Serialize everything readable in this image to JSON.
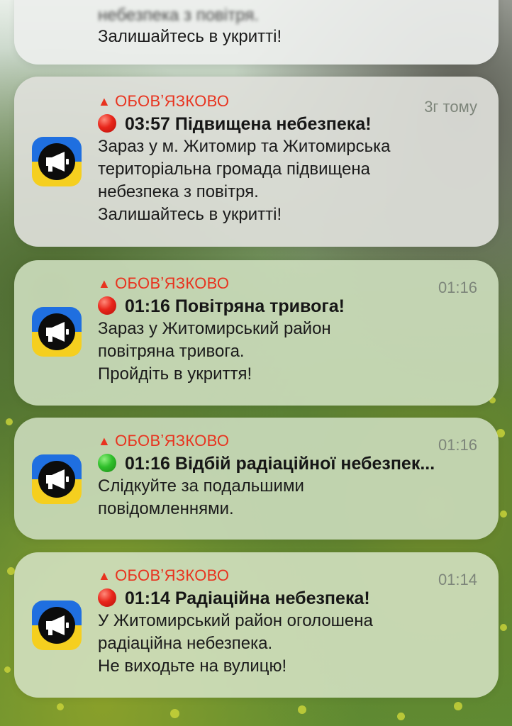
{
  "colors": {
    "mandatory_red": "#e8331f",
    "time_gray": "#7d857a",
    "alert_red": "#e8261b",
    "all_clear_green": "#2fbf2b",
    "icon_blue": "#1f6fe0",
    "icon_yellow": "#f5cf1f"
  },
  "app_icon": "megaphone-icon",
  "top_partial": {
    "blurred_line": "небезпека з повітря.",
    "body_line": "Залишайтесь в укритті!"
  },
  "notifications": [
    {
      "tag": "ОБОВʼЯЗКОВО",
      "time": "3г тому",
      "status_dot": "red",
      "title": "03:57 Підвищена небезпека!",
      "body": "Зараз у м. Житомир та Житомирська\nтериторіальна громада підвищена\nнебезпека з повітря.\nЗалишайтесь в укритті!"
    },
    {
      "tag": "ОБОВʼЯЗКОВО",
      "time": "01:16",
      "status_dot": "red",
      "title": "01:16 Повітряна тривога!",
      "body": "Зараз у Житомирський район\nповітряна тривога.\nПройдіть в укриття!"
    },
    {
      "tag": "ОБОВʼЯЗКОВО",
      "time": "01:16",
      "status_dot": "green",
      "title": "01:16 Відбій радіаційної небезпек...",
      "body": "Слідкуйте за подальшими\nповідомленнями."
    },
    {
      "tag": "ОБОВʼЯЗКОВО",
      "time": "01:14",
      "status_dot": "red",
      "title": "01:14 Радіаційна небезпека!",
      "body": "У Житомирський район оголошена\nрадіаційна небезпека.\nНе виходьте на вулицю!"
    }
  ]
}
